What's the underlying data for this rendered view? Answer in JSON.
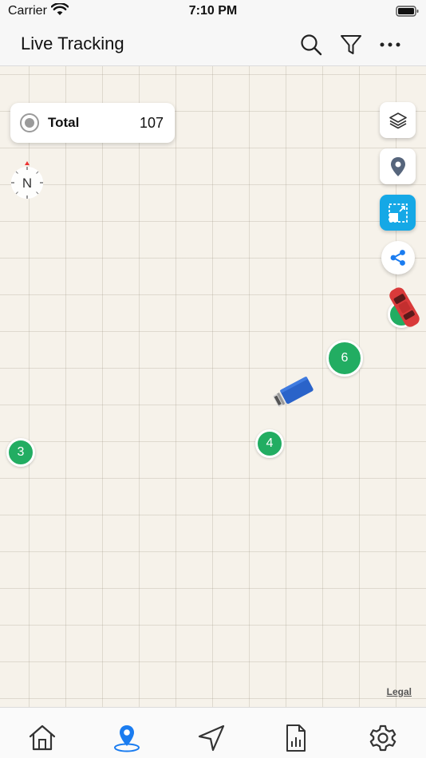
{
  "status_bar": {
    "carrier": "Carrier",
    "time": "7:10 PM"
  },
  "nav": {
    "title": "Live Tracking",
    "actions": [
      "search-icon",
      "filter-icon",
      "more-icon"
    ]
  },
  "filter_card": {
    "label": "Total",
    "count": "107"
  },
  "compass": {
    "heading": "N"
  },
  "map_controls": [
    {
      "name": "layers-button",
      "icon": "layers-icon"
    },
    {
      "name": "location-pin-button",
      "icon": "location-pin-icon"
    },
    {
      "name": "fit-view-button",
      "icon": "fit-view-icon",
      "active": true,
      "color": "#15a8e6"
    },
    {
      "name": "share-button",
      "icon": "share-icon"
    }
  ],
  "clusters": [
    {
      "count": "6"
    },
    {
      "count": "4"
    },
    {
      "count": "3"
    },
    {
      "count": ""
    }
  ],
  "vehicles": [
    {
      "type": "truck",
      "color": "#2a63c9"
    },
    {
      "type": "car",
      "color": "#d93a3a"
    }
  ],
  "map_footer": {
    "legal": "Legal"
  },
  "tabs": [
    {
      "label": "Home",
      "icon": "home-icon",
      "active": false
    },
    {
      "label": "Live Tracking",
      "icon": "map-pin-icon",
      "active": true
    },
    {
      "label": "Navigate",
      "icon": "navigation-arrow-icon",
      "active": false
    },
    {
      "label": "Reports",
      "icon": "report-icon",
      "active": false
    },
    {
      "label": "Settings",
      "icon": "settings-icon",
      "active": false
    }
  ],
  "colors": {
    "accent": "#1a7cf0",
    "cluster": "#22ad62",
    "map_bg": "#f6f2ea"
  }
}
